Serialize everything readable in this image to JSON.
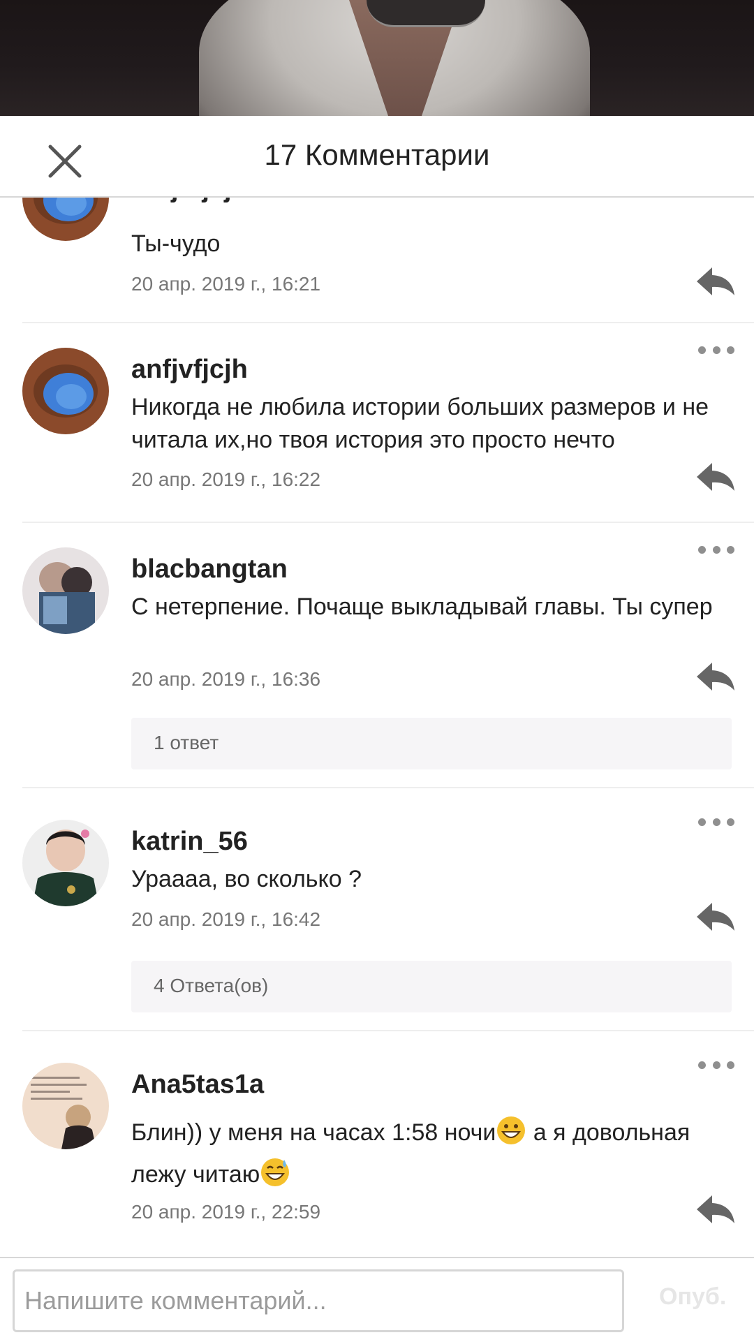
{
  "header": {
    "title": "17 Комментарии",
    "close_icon": "close-icon"
  },
  "comments": [
    {
      "username": "anfjvfjcjh",
      "text": "Ты-чудо",
      "time": "20 апр. 2019 г., 16:21",
      "avatar": "canyon-arch-photo"
    },
    {
      "username": "anfjvfjcjh",
      "text": "Никогда не любила истории больших размеров и не читала их,но твоя история это просто нечто",
      "time": "20 апр. 2019 г., 16:22",
      "avatar": "canyon-arch-photo"
    },
    {
      "username": "blacbangtan",
      "text": "С нетерпение. Почаще выкладывай главы. Ты супер",
      "time": "20 апр. 2019 г., 16:36",
      "replies": "1 ответ",
      "avatar": "couple-photo"
    },
    {
      "username": "katrin_56",
      "text": "Ураааа, во сколько ?",
      "time": "20 апр. 2019 г., 16:42",
      "replies": "4 Ответа(ов)",
      "avatar": "person-dark-jacket-photo"
    },
    {
      "username": "Ana5tas1a",
      "text_part1": "Блин)) у меня на часах 1:58 ночи",
      "text_part2": " а я довольная лежу читаю",
      "emoji1": "grinning-face-emoji",
      "emoji2": "sweat-smile-emoji",
      "time": "20 апр. 2019 г., 22:59",
      "avatar": "text-quote-photo"
    }
  ],
  "composer": {
    "placeholder": "Напишите комментарий...",
    "publish_label": "Опуб."
  },
  "colors": {
    "text": "#222222",
    "muted": "#777777",
    "divider": "#eeeeee",
    "reply_box": "#f6f5f7",
    "publish_disabled": "#e6e6e6"
  }
}
